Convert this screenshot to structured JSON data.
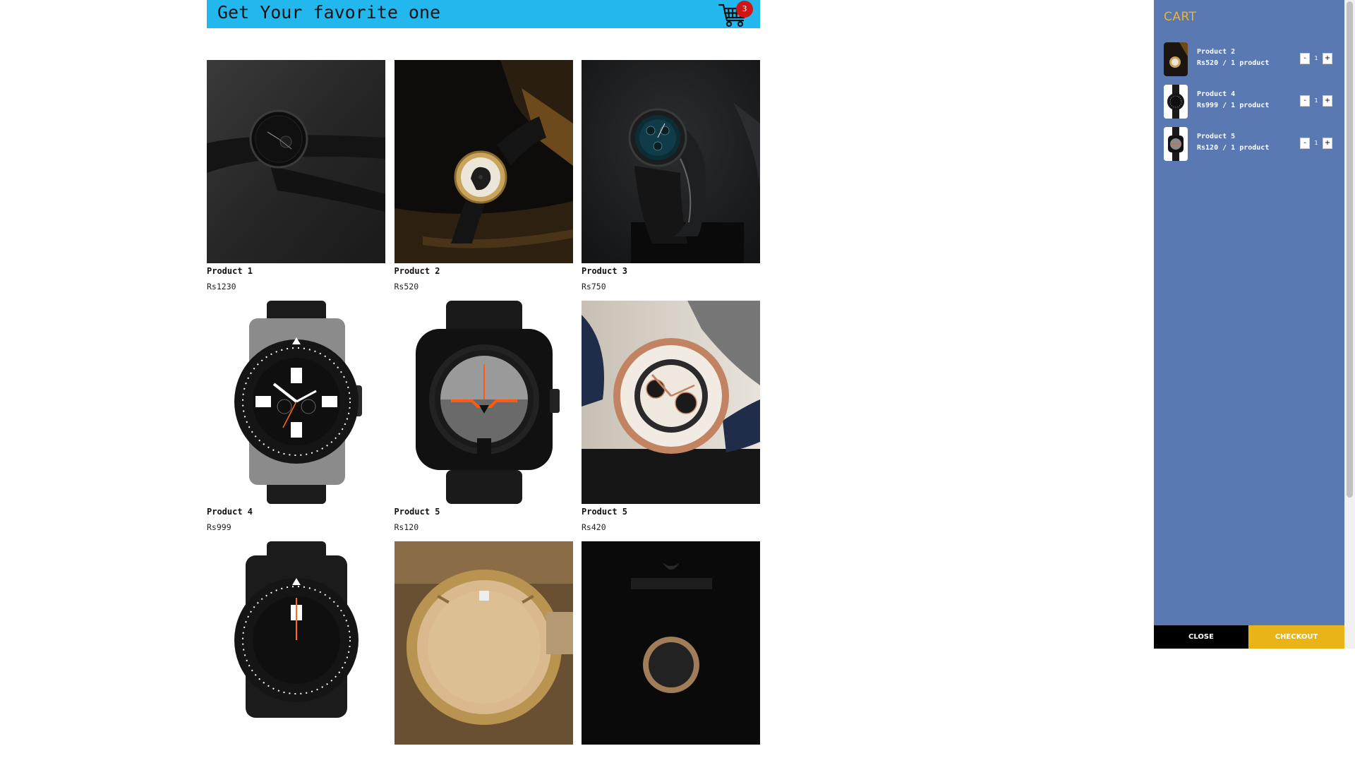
{
  "header": {
    "title": "Get Your favorite one",
    "cart_count": "3",
    "color": "#22b8ee"
  },
  "products": [
    {
      "name": "Product 1",
      "price": "Rs1230",
      "icon": "watch-image"
    },
    {
      "name": "Product 2",
      "price": "Rs520",
      "icon": "watch-image"
    },
    {
      "name": "Product 3",
      "price": "Rs750",
      "icon": "watch-image"
    },
    {
      "name": "Product 4",
      "price": "Rs999",
      "icon": "watch-image"
    },
    {
      "name": "Product 5",
      "price": "Rs120",
      "icon": "watch-image"
    },
    {
      "name": "Product 5",
      "price": "Rs420",
      "icon": "watch-image"
    }
  ],
  "cart": {
    "heading": "CART",
    "items": [
      {
        "name": "Product 2",
        "price": "Rs520 / 1 product",
        "qty": "1",
        "minus": "-",
        "plus": "+"
      },
      {
        "name": "Product 4",
        "price": "Rs999 / 1 product",
        "qty": "1",
        "minus": "-",
        "plus": "+"
      },
      {
        "name": "Product 5",
        "price": "Rs120 / 1 product",
        "qty": "1",
        "minus": "-",
        "plus": "+"
      }
    ],
    "close_label": "CLOSE",
    "checkout_label": "CHECKOUT",
    "panel_color": "#5a78b1",
    "heading_color": "#f0b429",
    "checkout_color": "#e8b418"
  }
}
